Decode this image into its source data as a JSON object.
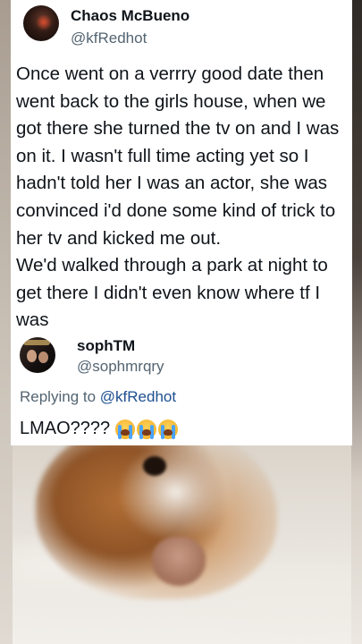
{
  "tweet": {
    "author_name": "Chaos McBueno",
    "author_handle": "@kfRedhot",
    "body_lines": [
      "Once went on a verrry good date then went back to the girls house, when we got there she turned the tv on and I was on it. I wasn't full time acting yet so I hadn't told her I was an actor, she was convinced i'd done some kind of trick to her tv and kicked me out.",
      "We'd walked through a park at night to get there I didn't even know where tf I was"
    ]
  },
  "reply": {
    "author_name": "sophTM",
    "author_handle": "@sophmrqry",
    "replying_prefix": "Replying to ",
    "replying_to": "@kfRedhot",
    "text": "LMAO????"
  },
  "icons": {
    "reply_emoji": "loudly-crying-face-icon",
    "reply_emoji_count": 3
  },
  "colors": {
    "text": "#0f1419",
    "secondary": "#536471",
    "mention": "#1d4f91"
  }
}
